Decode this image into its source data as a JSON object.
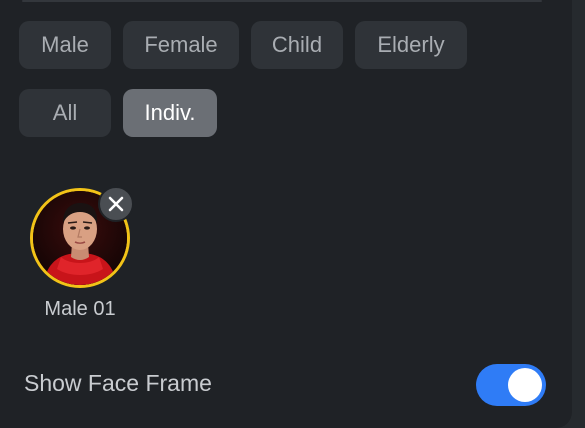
{
  "categories": {
    "row1": [
      {
        "label": "Male",
        "selected": false
      },
      {
        "label": "Female",
        "selected": false
      },
      {
        "label": "Child",
        "selected": false
      },
      {
        "label": "Elderly",
        "selected": false
      }
    ],
    "row2": [
      {
        "label": "All",
        "selected": false
      },
      {
        "label": "Indiv.",
        "selected": true
      }
    ]
  },
  "faces": [
    {
      "label": "Male 01",
      "highlight_color": "#f2c318"
    }
  ],
  "settings": {
    "show_face_frame": {
      "label": "Show Face Frame",
      "enabled": true
    }
  },
  "colors": {
    "accent": "#2f7cf6",
    "selection_ring": "#f2c318",
    "selected_chip": "#6b6f75"
  },
  "icons": {
    "remove": "close-icon"
  }
}
